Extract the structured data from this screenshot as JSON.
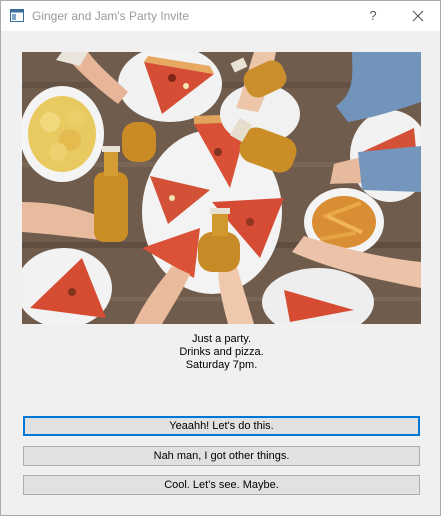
{
  "window": {
    "title": "Ginger and Jam's Party Invite",
    "help_label": "?"
  },
  "icons": {
    "app": "window-icon",
    "help": "question-mark",
    "close": "x-close"
  },
  "colors": {
    "focus_border": "#0078d7",
    "button_face": "#e1e1e1",
    "window_bg": "#f0f0f0"
  },
  "invite": {
    "lines": [
      "Just a party.",
      "Drinks and pizza.",
      "Saturday 7pm."
    ]
  },
  "buttons": {
    "accept": "Yeaahh! Let's do this.",
    "decline": "Nah man, I got other things.",
    "maybe": "Cool. Let's see. Maybe."
  }
}
